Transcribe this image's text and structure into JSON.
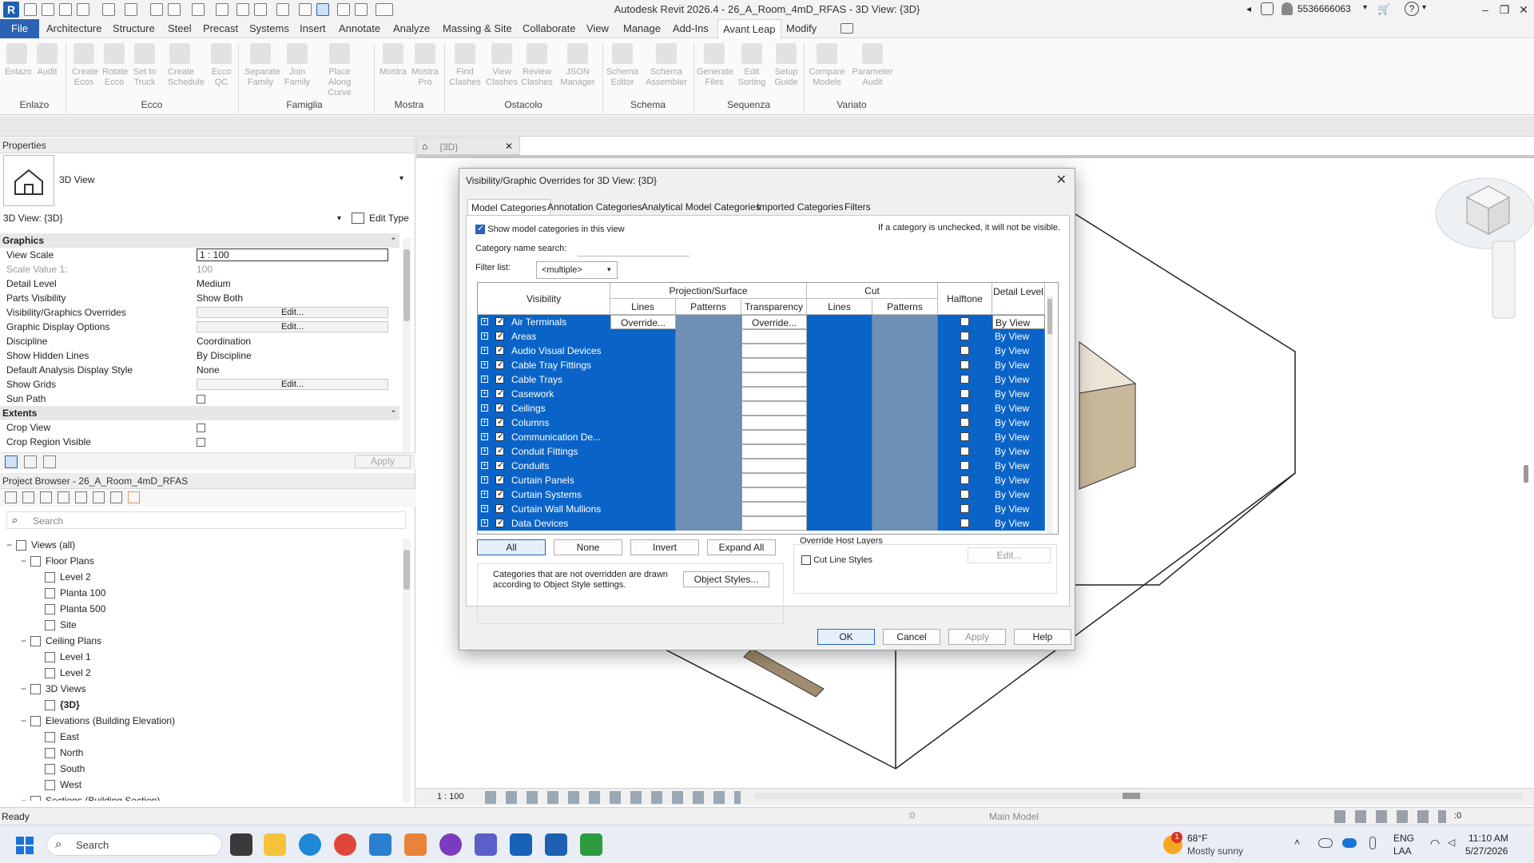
{
  "titlebar": {
    "app_title": "Autodesk Revit 2026.4 - 26_A_Room_4mD_RFAS - 3D View: {3D}",
    "user": "5536666063",
    "logo": "R"
  },
  "menu": [
    "File",
    "Architecture",
    "Structure",
    "Steel",
    "Precast",
    "Systems",
    "Insert",
    "Annotate",
    "Analyze",
    "Massing & Site",
    "Collaborate",
    "View",
    "Manage",
    "Add-Ins",
    "Avant Leap",
    "Modify"
  ],
  "ribbon": {
    "buttons": [
      {
        "label": "Enlazo"
      },
      {
        "label": "Audit"
      },
      {
        "label": "Create Ecos"
      },
      {
        "label": "Rotate Ecco"
      },
      {
        "label": "Set to Truck"
      },
      {
        "label": "Create Schedule"
      },
      {
        "label": "Ecco QC"
      },
      {
        "label": "Separate Family"
      },
      {
        "label": "Join Family"
      },
      {
        "label": "Place Along Curve"
      },
      {
        "label": "Mostra"
      },
      {
        "label": "Mostra Pro"
      },
      {
        "label": "Find Clashes"
      },
      {
        "label": "View Clashes"
      },
      {
        "label": "Review Clashes"
      },
      {
        "label": "JSON Manager"
      },
      {
        "label": "Schema Editor"
      },
      {
        "label": "Schema Assembler"
      },
      {
        "label": "Generate Files"
      },
      {
        "label": "Edit Sorting"
      },
      {
        "label": "Setup Guide"
      },
      {
        "label": "Compare Models"
      },
      {
        "label": "Parameter Audit"
      }
    ],
    "groups": [
      "Enlazo",
      "Ecco",
      "Famiglia",
      "Mostra",
      "Ostacolo",
      "Schema",
      "Sequenza",
      "Variato"
    ]
  },
  "properties": {
    "header": "Properties",
    "type_name": "3D View",
    "instance_selector": "3D View: {3D}",
    "edit_type": "Edit Type",
    "section_graphics": "Graphics",
    "rows": [
      {
        "k": "View Scale",
        "v": "1 : 100"
      },
      {
        "k": "Scale Value    1:",
        "v": "100"
      },
      {
        "k": "Detail Level",
        "v": "Medium"
      },
      {
        "k": "Parts Visibility",
        "v": "Show Both"
      },
      {
        "k": "Visibility/Graphics Overrides",
        "v": "Edit..."
      },
      {
        "k": "Graphic Display Options",
        "v": "Edit..."
      },
      {
        "k": "Discipline",
        "v": "Coordination"
      },
      {
        "k": "Show Hidden Lines",
        "v": "By Discipline"
      },
      {
        "k": "Default Analysis Display Style",
        "v": "None"
      },
      {
        "k": "Show Grids",
        "v": "Edit..."
      },
      {
        "k": "Sun Path",
        "v": ""
      }
    ],
    "section_extents": "Extents",
    "extents_rows": [
      {
        "k": "Crop View",
        "v": ""
      },
      {
        "k": "Crop Region Visible",
        "v": ""
      }
    ],
    "apply": "Apply"
  },
  "browser": {
    "header": "Project Browser - 26_A_Room_4mD_RFAS",
    "search_placeholder": "Search",
    "tree": [
      {
        "label": "Views (all)",
        "level": 0,
        "tog": "−"
      },
      {
        "label": "Floor Plans",
        "level": 1,
        "tog": "−"
      },
      {
        "label": "Level 2",
        "level": 2
      },
      {
        "label": "Planta 100",
        "level": 2
      },
      {
        "label": "Planta 500",
        "level": 2
      },
      {
        "label": "Site",
        "level": 2
      },
      {
        "label": "Ceiling Plans",
        "level": 1,
        "tog": "−"
      },
      {
        "label": "Level 1",
        "level": 2
      },
      {
        "label": "Level 2",
        "level": 2
      },
      {
        "label": "3D Views",
        "level": 1,
        "tog": "−"
      },
      {
        "label": "{3D}",
        "level": 2,
        "bold": true
      },
      {
        "label": "Elevations (Building Elevation)",
        "level": 1,
        "tog": "−"
      },
      {
        "label": "East",
        "level": 2
      },
      {
        "label": "North",
        "level": 2
      },
      {
        "label": "South",
        "level": 2
      },
      {
        "label": "West",
        "level": 2
      },
      {
        "label": "Sections (Building Section)",
        "level": 1,
        "tog": "−"
      }
    ]
  },
  "viewtab": {
    "label": "{3D}"
  },
  "dialog": {
    "title": "Visibility/Graphic Overrides for 3D View: {3D}",
    "tabs": [
      "Model Categories",
      "Annotation Categories",
      "Analytical Model Categories",
      "Imported Categories",
      "Filters"
    ],
    "show_model_categories": "Show model categories in this view",
    "hint": "If a category is unchecked, it will not be visible.",
    "category_search_label": "Category name search:",
    "filter_list_label": "Filter list:",
    "filter_list_value": "<multiple>",
    "headers": {
      "visibility": "Visibility",
      "projection": "Projection/Surface",
      "cut": "Cut",
      "lines": "Lines",
      "patterns": "Patterns",
      "transparency": "Transparency",
      "halftone": "Halftone",
      "detail_level": "Detail Level"
    },
    "rows": [
      {
        "name": "Air Terminals",
        "lines": "Override...",
        "transparency": "Override...",
        "detail": "By View",
        "first": true
      },
      {
        "name": "Areas",
        "detail": "By View"
      },
      {
        "name": "Audio Visual Devices",
        "detail": "By View"
      },
      {
        "name": "Cable Tray Fittings",
        "detail": "By View"
      },
      {
        "name": "Cable Trays",
        "detail": "By View"
      },
      {
        "name": "Casework",
        "detail": "By View"
      },
      {
        "name": "Ceilings",
        "detail": "By View"
      },
      {
        "name": "Columns",
        "detail": "By View"
      },
      {
        "name": "Communication De...",
        "detail": "By View"
      },
      {
        "name": "Conduit Fittings",
        "detail": "By View"
      },
      {
        "name": "Conduits",
        "detail": "By View"
      },
      {
        "name": "Curtain Panels",
        "detail": "By View"
      },
      {
        "name": "Curtain Systems",
        "detail": "By View"
      },
      {
        "name": "Curtain Wall Mullions",
        "detail": "By View"
      },
      {
        "name": "Data Devices",
        "detail": "By View"
      }
    ],
    "buttons": {
      "all": "All",
      "none": "None",
      "invert": "Invert",
      "expand_all": "Expand All"
    },
    "override_host_layers": "Override Host Layers",
    "cut_line_styles": "Cut Line Styles",
    "edit": "Edit...",
    "note": "Categories that are not overridden are drawn according to Object Style settings.",
    "object_styles": "Object Styles...",
    "ok": "OK",
    "cancel": "Cancel",
    "apply": "Apply",
    "help": "Help"
  },
  "viewbar": {
    "scale": "1 : 100"
  },
  "status": {
    "left": "Ready",
    "model": "Main Model",
    "count_a": ":0",
    "count_b": ":0"
  },
  "taskbar": {
    "search": "Search",
    "weather_temp": "68°F",
    "weather_desc": "Mostly sunny",
    "lang": "ENG",
    "lang2": "LAA",
    "time": "11:10 AM",
    "date": "5/27/2026",
    "badge": "1"
  },
  "colors": {
    "selection": "#0a64c8",
    "accent": "#2b62b4"
  }
}
